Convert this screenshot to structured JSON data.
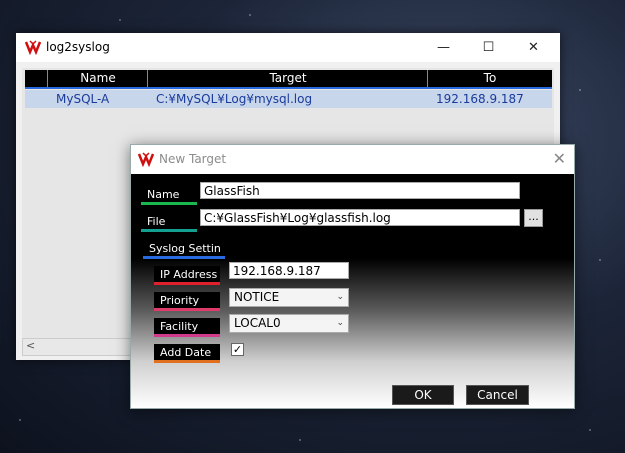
{
  "main_window": {
    "title": "log2syslog",
    "controls": {
      "minimize": "—",
      "maximize": "☐",
      "close": "✕"
    },
    "columns": [
      "Name",
      "Target",
      "To"
    ],
    "rows": [
      {
        "name": "MySQL-A",
        "target": "C:¥MySQL¥Log¥mysql.log",
        "to": "192.168.9.187"
      }
    ],
    "scroll_left_arrow": "<"
  },
  "dialog": {
    "title": "New Target",
    "close": "✕",
    "labels": {
      "name": "Name",
      "file": "File",
      "syslog_settings": "Syslog Settin",
      "ip_address": "IP Address",
      "priority": "Priority",
      "facility": "Facility",
      "add_date": "Add Date"
    },
    "values": {
      "name": "GlassFish",
      "file": "C:¥GlassFish¥Log¥glassfish.log",
      "ip_address": "192.168.9.187",
      "priority": "NOTICE",
      "facility": "LOCAL0",
      "add_date_checked": "✓"
    },
    "browse_label": "...",
    "ok_label": "OK",
    "cancel_label": "Cancel"
  },
  "colors": {
    "accent_blue": "#2a6ae0",
    "label_green": "#18b84e",
    "label_red": "#e0202a",
    "label_orange": "#e07020"
  }
}
